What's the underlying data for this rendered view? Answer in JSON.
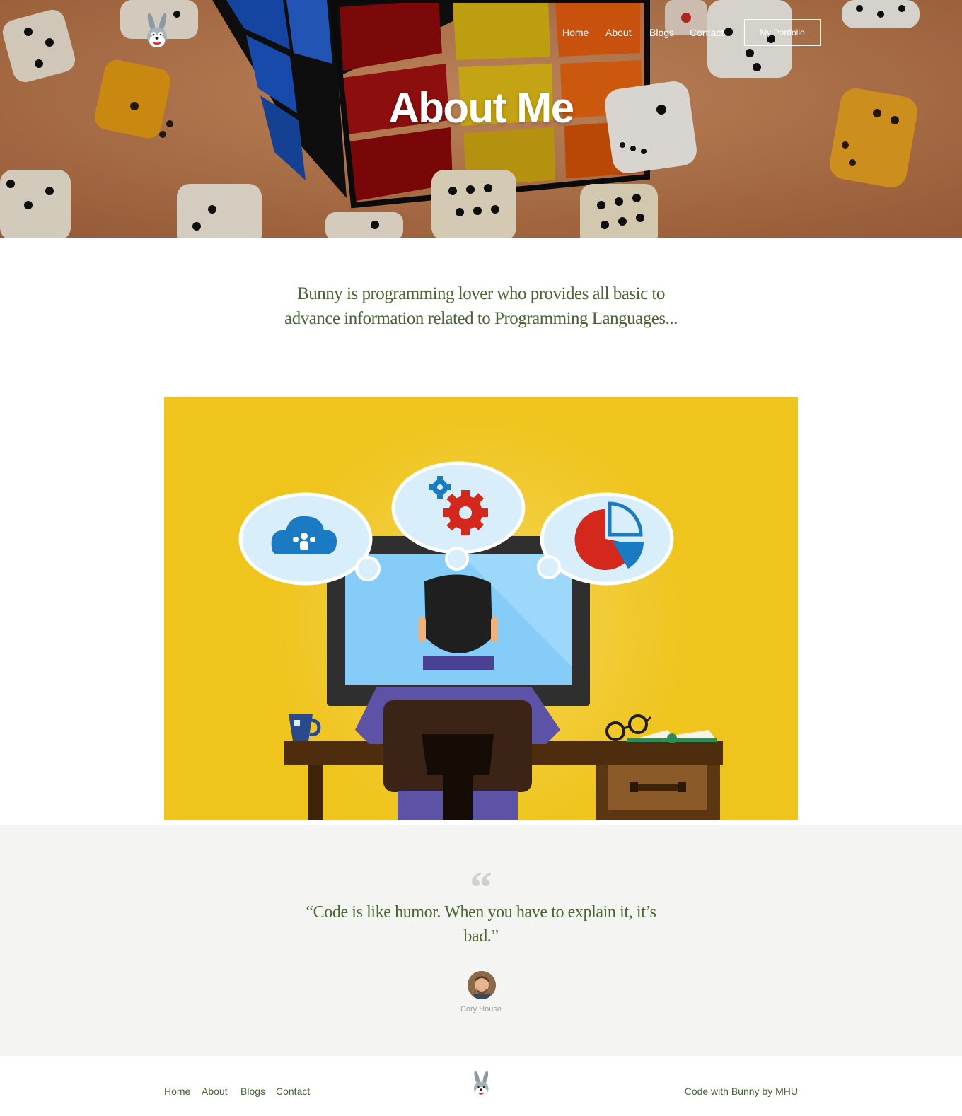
{
  "header": {
    "nav": [
      "Home",
      "About",
      "Blogs",
      "Contact"
    ],
    "portfolio_button": "My Portfolio",
    "logo_icon": "bunny-logo-icon"
  },
  "hero": {
    "title": "About Me",
    "background": "dice-and-rubiks-cube-photo"
  },
  "intro": {
    "text": "Bunny is programming lover who provides all basic to advance information related to Programming Languages..."
  },
  "illustration": {
    "description_icons": [
      "cloud-users-icon",
      "gears-icon",
      "pie-chart-icon"
    ],
    "background_color": "#efc41d"
  },
  "quote": {
    "mark": "“",
    "text": "“Code is like humor. When you have to explain it, it’s bad.”",
    "author": "Cory House"
  },
  "footer": {
    "nav": [
      "Home",
      "About",
      "Blogs",
      "Contact"
    ],
    "credit": "Code with Bunny by MHU"
  },
  "colors": {
    "accent_green": "#4b6332",
    "quote_bg": "#f4f5f2",
    "illustration_yellow": "#efc41d"
  }
}
